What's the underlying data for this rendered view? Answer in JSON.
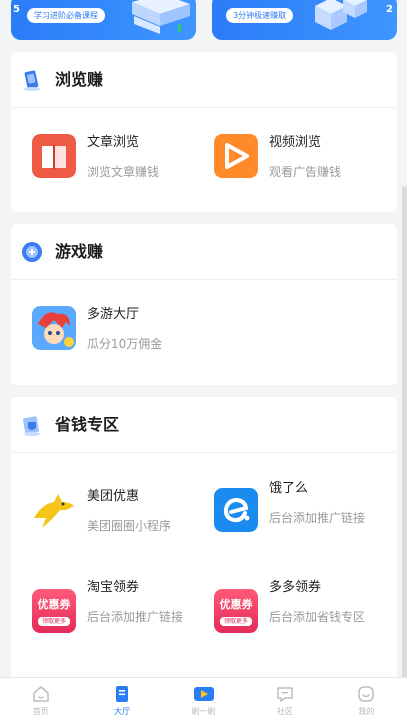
{
  "banners": [
    {
      "lead": "5",
      "pill": "学习进阶必备课程"
    },
    {
      "lead": "2",
      "pill": "3分钟极速赚取"
    }
  ],
  "sections": [
    {
      "title": "浏览赚",
      "items": [
        {
          "name": "文章浏览",
          "desc": "浏览文章赚钱"
        },
        {
          "name": "视频浏览",
          "desc": "观看广告赚钱"
        }
      ]
    },
    {
      "title": "游戏赚",
      "items": [
        {
          "name": "多游大厅",
          "desc": "瓜分10万佣金"
        }
      ]
    },
    {
      "title": "省钱专区",
      "items": [
        {
          "name": "美团优惠",
          "desc": "美团圈圈小程序"
        },
        {
          "name": "饿了么",
          "desc": "后台添加推广链接"
        },
        {
          "name": "淘宝领券",
          "desc": "后台添加推广链接"
        },
        {
          "name": "多多领券",
          "desc": "后台添加省钱专区"
        }
      ]
    }
  ],
  "coupon_icon_text": {
    "big": "优惠券",
    "small": "领取更多"
  },
  "tabbar": [
    {
      "label": "首页",
      "icon": "home-icon"
    },
    {
      "label": "大厅",
      "icon": "hall-icon",
      "active": true
    },
    {
      "label": "刷一刷",
      "icon": "video-icon"
    },
    {
      "label": "社区",
      "icon": "chat-icon"
    },
    {
      "label": "我的",
      "icon": "profile-icon"
    }
  ],
  "colors": {
    "accent": "#2a7cf7",
    "article_icon": "#ef5a44",
    "video_icon": "#ff8a2a",
    "meituan_icon": "#f5c518",
    "eleme_icon": "#1a8cf0",
    "coupon_icon": "#f0385e"
  }
}
